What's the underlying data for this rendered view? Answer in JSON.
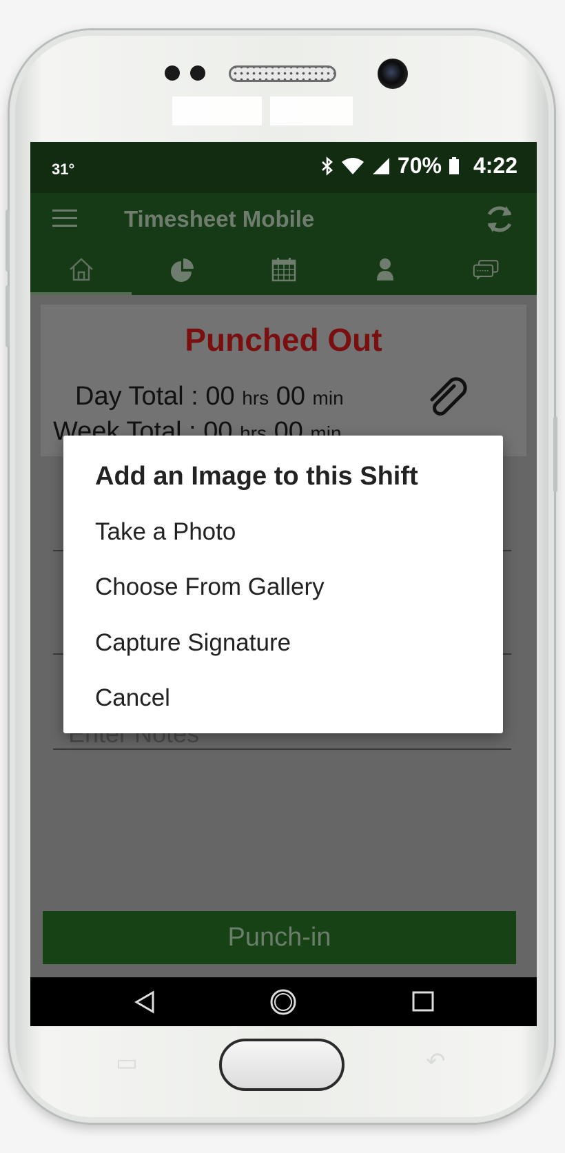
{
  "status_bar": {
    "temperature": "31°",
    "battery": "70%",
    "time": "4:22"
  },
  "app_bar": {
    "title": "Timesheet Mobile"
  },
  "tabs": [
    {
      "icon": "home-icon"
    },
    {
      "icon": "pie-chart-icon"
    },
    {
      "icon": "calendar-icon"
    },
    {
      "icon": "person-icon"
    },
    {
      "icon": "chat-icon"
    }
  ],
  "summary": {
    "status": "Punched Out",
    "day_label": "Day Total : ",
    "week_label": "Week Total : ",
    "hours_value": "00",
    "hours_unit": "hrs",
    "minutes_value": "00",
    "minutes_unit": "min"
  },
  "form": {
    "notes_placeholder": "Enter Notes"
  },
  "punch_button": {
    "label": "Punch-in"
  },
  "dialog": {
    "title": "Add an Image to this Shift",
    "options": [
      "Take a Photo",
      "Choose From Gallery",
      "Capture Signature",
      "Cancel"
    ]
  },
  "colors": {
    "status_bar": "#122c12",
    "app_bar": "#163916",
    "punched_out": "#7a0f0f",
    "button": "#164216",
    "overlay": "#666666"
  }
}
